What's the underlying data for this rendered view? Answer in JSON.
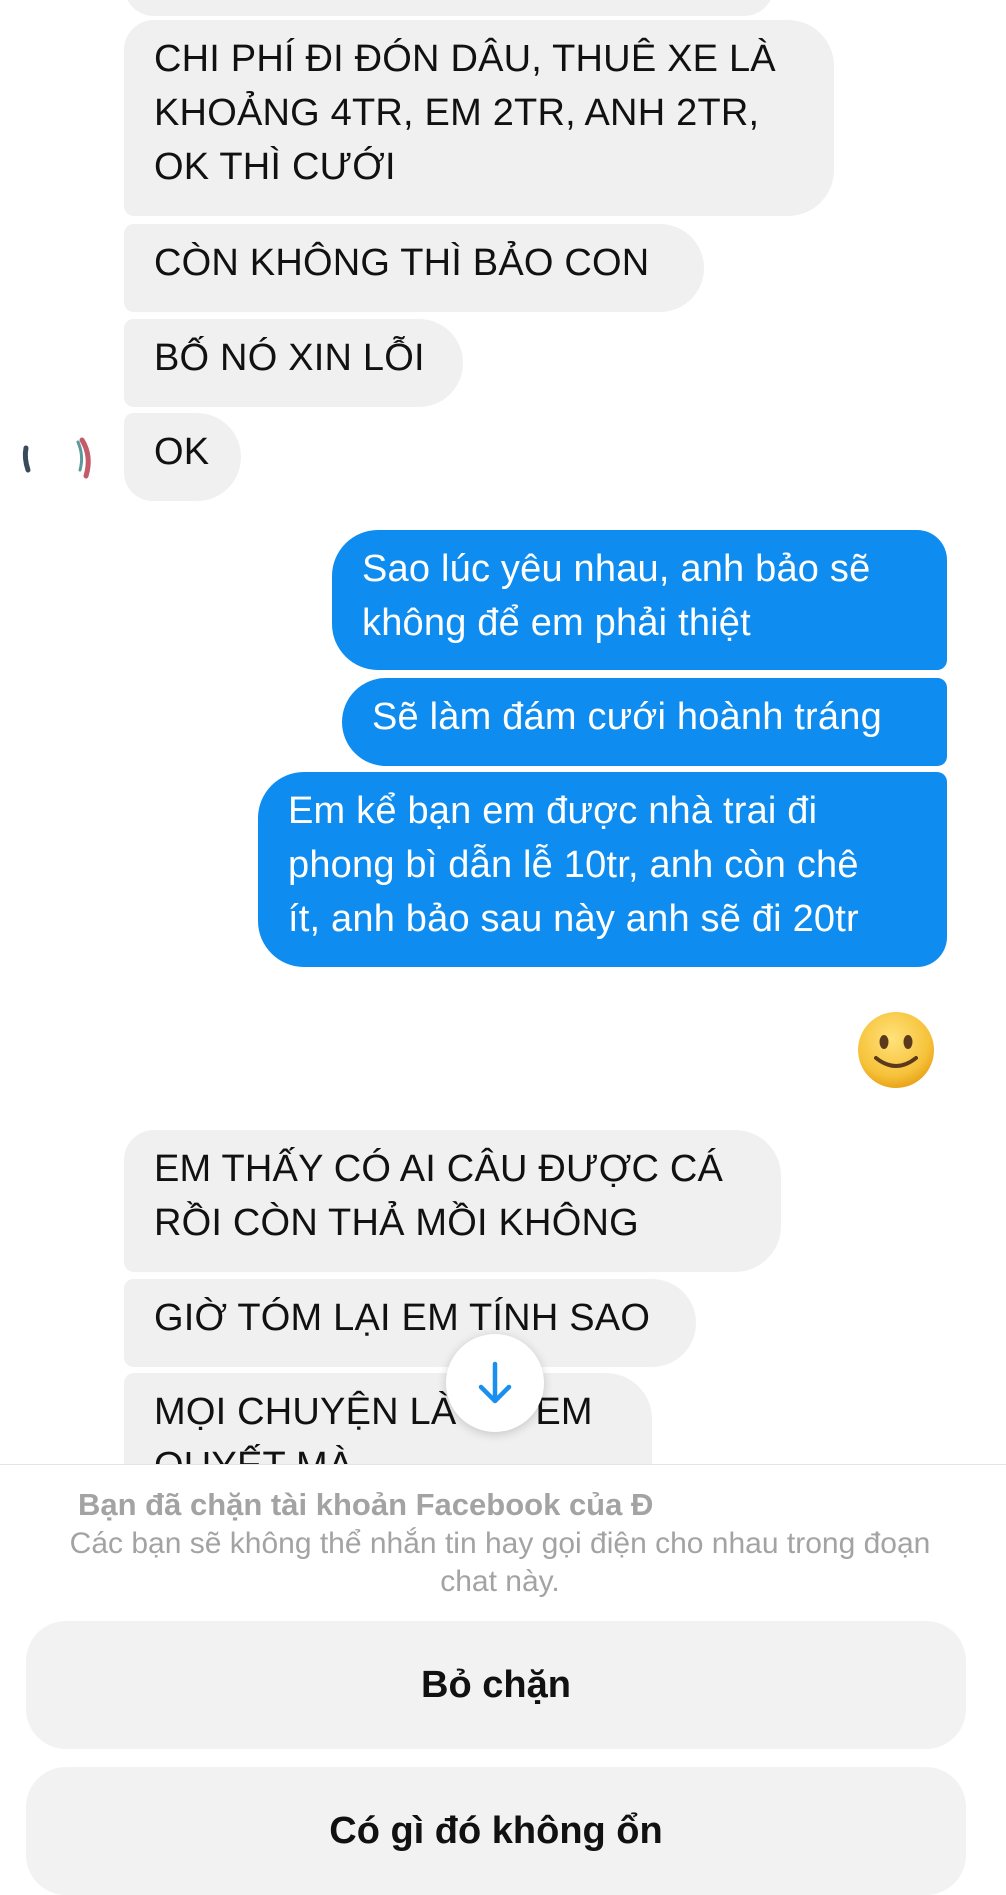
{
  "chat": {
    "incoming_top": [
      {
        "text_lines": [
          "CHI PHÍ ĐI ĐÓN DÂU, THUÊ XE LÀ",
          "KHOẢNG 4TR, EM 2TR, ANH 2TR,",
          "OK THÌ CƯỚI"
        ]
      },
      {
        "text_lines": [
          "CÒN KHÔNG THÌ BẢO CON"
        ]
      },
      {
        "text_lines": [
          "BỐ NÓ XIN LỖI"
        ]
      },
      {
        "text_lines": [
          "OK"
        ]
      }
    ],
    "outgoing": [
      {
        "text_lines": [
          "Sao lúc yêu nhau, anh bảo sẽ",
          "không để em phải thiệt"
        ]
      },
      {
        "text_lines": [
          "Sẽ làm đám cưới hoành tráng"
        ]
      },
      {
        "text_lines": [
          "Em kể bạn em được nhà trai đi",
          "phong bì dẫn lễ 10tr, anh còn chê",
          "ít, anh bảo sau này anh sẽ đi 20tr"
        ]
      }
    ],
    "incoming_bottom": [
      {
        "text_lines": [
          "EM THẤY CÓ AI CÂU ĐƯỢC CÁ",
          "RỒI CÒN THẢ MỒI KHÔNG"
        ]
      },
      {
        "text_lines": [
          "GIỜ TÓM LẠI EM TÍNH SAO"
        ]
      },
      {
        "text_lines": [
          "MỌI CHUYỆN LÀ DO EM",
          "QUYẾT MÀ"
        ]
      }
    ],
    "reaction_icon": "slightly-smiling-face-emoji",
    "scroll_icon": "arrow-down-icon"
  },
  "blocked": {
    "title": "Bạn đã chặn tài khoản Facebook của Đ",
    "description": "Các bạn sẽ không thể nhắn tin hay gọi điện cho nhau trong đoạn chat này."
  },
  "actions": {
    "unblock_label": "Bỏ chặn",
    "report_label": "Có gì đó không ổn"
  },
  "colors": {
    "outgoing_bubble": "#0f8cf0",
    "incoming_bubble": "#f0f0f0",
    "secondary_text": "#a3a3a3"
  }
}
